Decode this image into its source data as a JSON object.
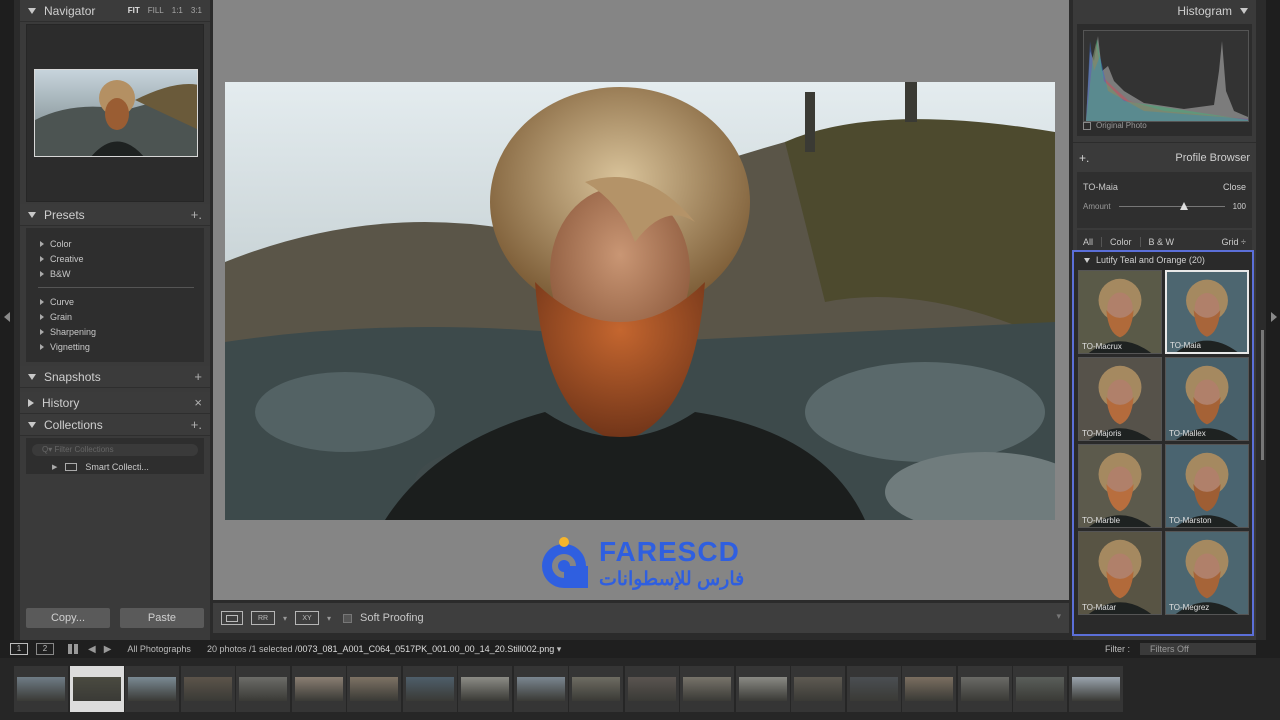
{
  "navigator": {
    "title": "Navigator",
    "modes": [
      "FIT",
      "FILL",
      "1:1",
      "3:1"
    ]
  },
  "presets": {
    "title": "Presets",
    "group1": [
      "Color",
      "Creative",
      "B&W"
    ],
    "group2": [
      "Curve",
      "Grain",
      "Sharpening",
      "Vignetting"
    ]
  },
  "snapshots": {
    "title": "Snapshots"
  },
  "history": {
    "title": "History"
  },
  "collections": {
    "title": "Collections",
    "filter_placeholder": "Q▾ Filter Collections",
    "smart": "Smart Collecti..."
  },
  "left_buttons": {
    "copy": "Copy...",
    "paste": "Paste"
  },
  "toolbar": {
    "soft_proofing": "Soft Proofing",
    "icon_compare": "XY",
    "icon_survey": "RR"
  },
  "watermark": {
    "brand": "FARESCD",
    "arabic": "فارس للإسطوانات"
  },
  "histogram": {
    "title": "Histogram",
    "original_photo": "Original Photo"
  },
  "profile_browser": {
    "title": "Profile Browser",
    "profile": "TO-Maia",
    "close": "Close",
    "amount_label": "Amount",
    "amount_value": "100",
    "amount_fraction": 0.58,
    "tabs": [
      "All",
      "Color",
      "B & W"
    ],
    "view": "Grid"
  },
  "profile_group": {
    "title": "Lutify Teal and Orange (20)",
    "tiles": [
      "TO-Macrux",
      "TO-Maia",
      "TO-Majoris",
      "TO-Mallex",
      "TO-Marble",
      "TO-Marston",
      "TO-Matar",
      "TO-Megrez"
    ],
    "selected": "TO-Maia"
  },
  "filmstrip_bar": {
    "screen1": "1",
    "screen2": "2",
    "source": "All Photographs",
    "info_prefix": "20 photos /1 selected /",
    "filename": "0073_081_A001_C064_0517PK_001.00_00_14_20.Still002.png",
    "filter_label": "Filter :",
    "filter_value": "Filters Off"
  },
  "filmstrip": {
    "count": 20,
    "selected_index": 1
  },
  "colors": {
    "accent": "#5b6fd8",
    "brand": "#2f5fe0"
  }
}
